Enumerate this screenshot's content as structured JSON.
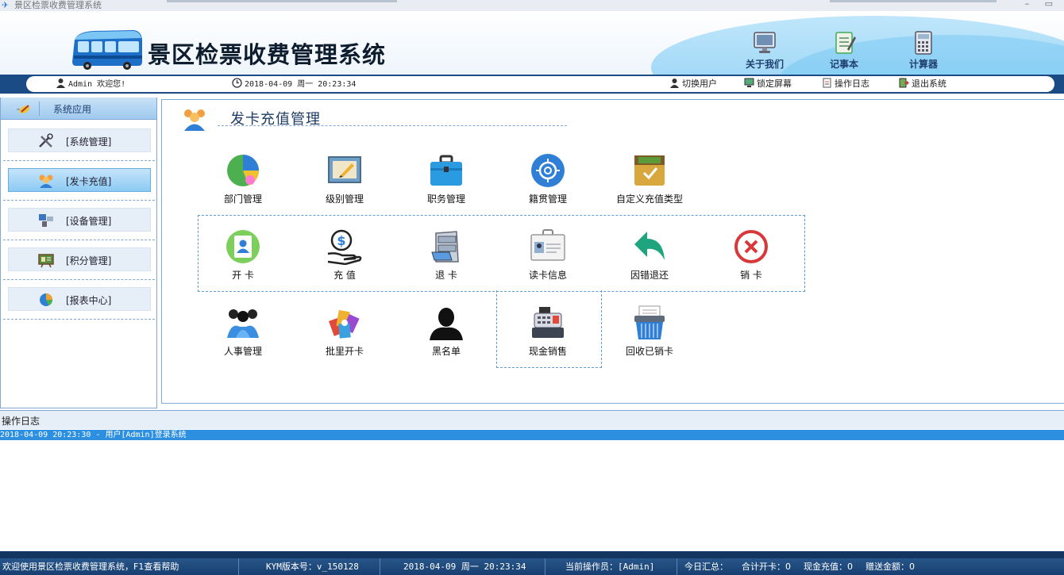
{
  "window": {
    "title": "景区检票收费管理系统",
    "controls": "– ▭"
  },
  "header": {
    "app_title": "景区检票收费管理系统",
    "tools": [
      {
        "label": "关于我们",
        "icon": "monitor-icon"
      },
      {
        "label": "记事本",
        "icon": "notepad-icon"
      },
      {
        "label": "计算器",
        "icon": "calculator-icon"
      }
    ]
  },
  "navbar": {
    "welcome": "Admin 欢迎您!",
    "datetime": "2018-04-09 周一 20:23:34",
    "actions": [
      {
        "label": "切换用户",
        "icon": "switch-user-icon"
      },
      {
        "label": "锁定屏幕",
        "icon": "lock-screen-icon"
      },
      {
        "label": "操作日志",
        "icon": "log-icon"
      },
      {
        "label": "退出系统",
        "icon": "exit-icon"
      }
    ]
  },
  "sidebar": {
    "header": "系统应用",
    "items": [
      {
        "label": "[系统管理]",
        "icon": "tools-icon",
        "active": false
      },
      {
        "label": "[发卡充值]",
        "icon": "users-icon",
        "active": true
      },
      {
        "label": "[设备管理]",
        "icon": "device-icon",
        "active": false
      },
      {
        "label": "[积分管理]",
        "icon": "points-icon",
        "active": false
      },
      {
        "label": "[报表中心]",
        "icon": "pie-chart-icon",
        "active": false
      }
    ]
  },
  "main": {
    "title": "发卡充值管理",
    "row1": [
      {
        "label": "部门管理",
        "icon": "department-icon"
      },
      {
        "label": "级别管理",
        "icon": "level-icon"
      },
      {
        "label": "职务管理",
        "icon": "briefcase-icon"
      },
      {
        "label": "籍贯管理",
        "icon": "origin-icon"
      },
      {
        "label": "自定义充值类型",
        "icon": "custom-recharge-icon"
      }
    ],
    "row2": [
      {
        "label": "开 卡",
        "icon": "open-card-icon"
      },
      {
        "label": "充 值",
        "icon": "recharge-icon"
      },
      {
        "label": "退 卡",
        "icon": "return-card-icon"
      },
      {
        "label": "读卡信息",
        "icon": "read-card-icon"
      },
      {
        "label": "因错退还",
        "icon": "undo-icon"
      },
      {
        "label": "销 卡",
        "icon": "cancel-card-icon"
      }
    ],
    "row3": [
      {
        "label": "人事管理",
        "icon": "personnel-icon"
      },
      {
        "label": "批里开卡",
        "icon": "batch-card-icon"
      },
      {
        "label": "黑名单",
        "icon": "blacklist-icon"
      },
      {
        "label": "现金销售",
        "icon": "cash-register-icon"
      },
      {
        "label": "回收已销卡",
        "icon": "recycle-icon"
      }
    ]
  },
  "log": {
    "header": "操作日志",
    "entries": [
      "2018-04-09 20:23:30 - 用户[Admin]登录系统"
    ]
  },
  "status": {
    "welcome": "欢迎使用景区检票收费管理系统，F1查看帮助",
    "version": "KYM版本号：v_150128",
    "datetime": "2018-04-09 周一 20:23:34",
    "operator": "当前操作员：[Admin]",
    "today": "今日汇总：",
    "total_cards": "合计开卡：0",
    "cash_recharge": "现金充值：0",
    "gift_amount": "赠送金额：0"
  },
  "colors": {
    "nav_bar": "#1b4b84",
    "accent": "#2d8fe0",
    "panel_border": "#7fa9d3"
  }
}
